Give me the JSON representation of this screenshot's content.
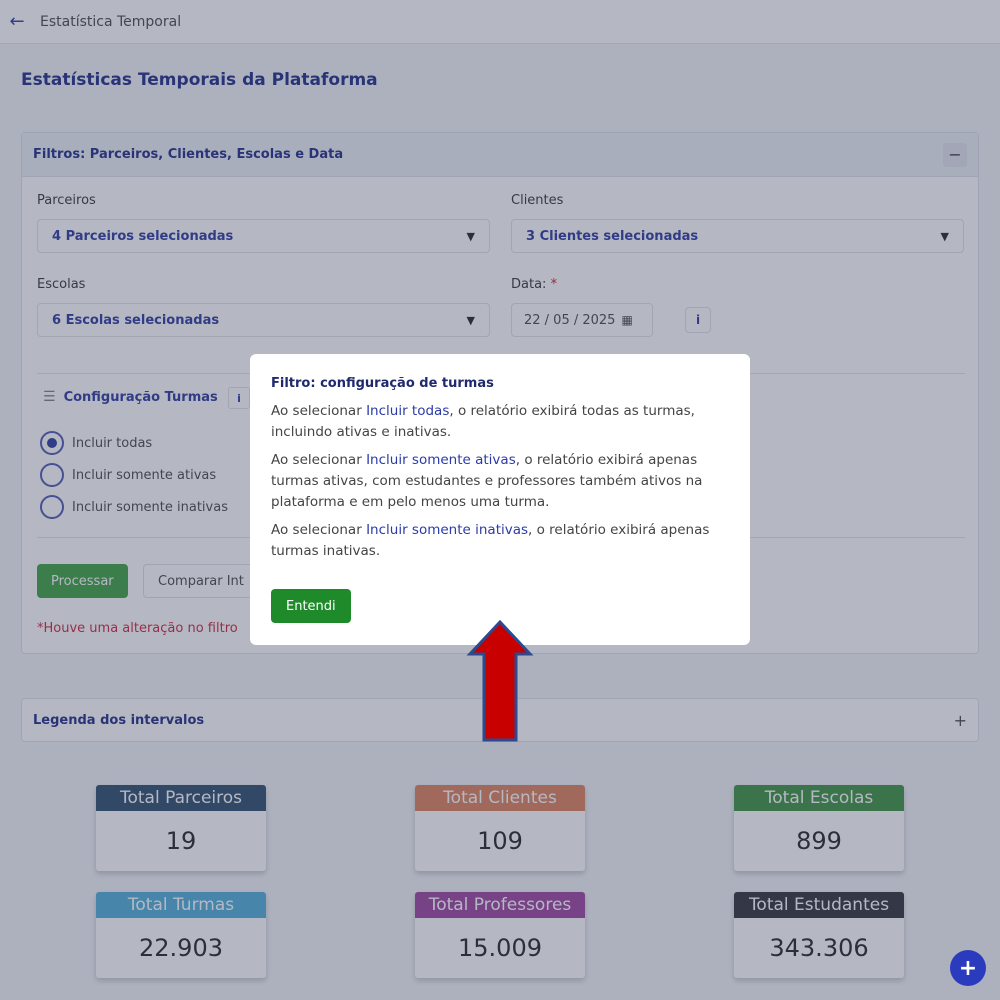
{
  "topbar": {
    "title": "Estatística Temporal",
    "back_icon": "arrow-left-icon"
  },
  "page": {
    "title": "Estatísticas Temporais da Plataforma"
  },
  "filters": {
    "header": "Filtros: Parceiros, Clientes, Escolas e Data",
    "collapse_label": "−",
    "parceiros": {
      "label": "Parceiros",
      "value": "4 Parceiros selecionadas"
    },
    "clientes": {
      "label": "Clientes",
      "value": "3 Clientes selecionadas"
    },
    "escolas": {
      "label": "Escolas",
      "value": "6 Escolas selecionadas"
    },
    "data": {
      "label": "Data:",
      "required_mark": "*",
      "value": "22 / 05 / 2025"
    },
    "info_label": "i"
  },
  "turmas": {
    "title": "Configuração Turmas",
    "info_label": "i",
    "options": [
      {
        "label": "Incluir todas",
        "checked": true
      },
      {
        "label": "Incluir somente ativas",
        "checked": false
      },
      {
        "label": "Incluir somente inativas",
        "checked": false
      }
    ]
  },
  "actions": {
    "process_label": "Processar",
    "compare_label": "Comparar Int",
    "warning": "*Houve uma alteração no filtro"
  },
  "legend": {
    "title": "Legenda dos intervalos",
    "expand_label": "+"
  },
  "stats": [
    {
      "label": "Total Parceiros",
      "value": "19",
      "color": "#3b5a78"
    },
    {
      "label": "Total Clientes",
      "value": "109",
      "color": "#e08a66"
    },
    {
      "label": "Total Escolas",
      "value": "899",
      "color": "#4a9a4e"
    },
    {
      "label": "Total Turmas",
      "value": "22.903",
      "color": "#5bb3dc"
    },
    {
      "label": "Total Professores",
      "value": "15.009",
      "color": "#a44fa6"
    },
    {
      "label": "Total Estudantes",
      "value": "343.306",
      "color": "#3f3f47"
    }
  ],
  "fab_label": "+",
  "modal": {
    "title": "Filtro: configuração de turmas",
    "p1_pre": "Ao selecionar ",
    "p1_hl": "Incluir todas",
    "p1_post": ", o relatório exibirá todas as turmas, incluindo ativas e inativas.",
    "p2_pre": "Ao selecionar ",
    "p2_hl": "Incluir somente ativas",
    "p2_post": ", o relatório exibirá apenas turmas ativas, com estudantes e professores também ativos na plataforma e em pelo menos uma turma.",
    "p3_pre": "Ao selecionar ",
    "p3_hl": "Incluir somente inativas",
    "p3_post": ", o relatório exibirá apenas turmas inativas.",
    "button_label": "Entendi"
  },
  "annotation": {
    "arrow_color": "#c80000",
    "arrow_outline": "#2b4a8f"
  }
}
